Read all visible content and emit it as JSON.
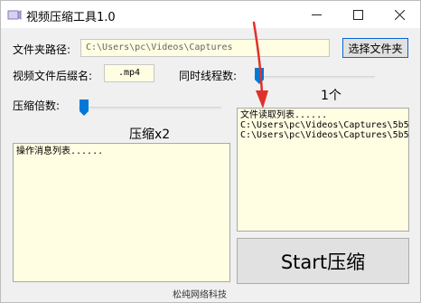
{
  "window": {
    "title": "视频压缩工具1.0",
    "icons": {
      "app": "app-icon",
      "minimize": "minimize-icon",
      "maximize": "maximize-icon",
      "close": "close-icon"
    }
  },
  "folder": {
    "label": "文件夹路径:",
    "path": "C:\\Users\\pc\\Videos\\Captures",
    "choose_button": "选择文件夹"
  },
  "extension": {
    "label": "视频文件后缀名:",
    "value": ".mp4"
  },
  "threads": {
    "label": "同时线程数:",
    "value_text": "1个",
    "slider_value": 1
  },
  "compression": {
    "label": "压缩倍数:",
    "value_text": "压缩x2",
    "slider_value": 2
  },
  "messages": {
    "lines": [
      "操作消息列表......"
    ]
  },
  "file_list": {
    "lines": [
      "文件读取列表......",
      "C:\\Users\\pc\\Videos\\Captures\\5b5",
      "C:\\Users\\pc\\Videos\\Captures\\5b5"
    ]
  },
  "start_button": "Start压缩",
  "footer": "松纯网络科技",
  "colors": {
    "window_bg": "#f0f0f0",
    "panel_bg": "#fffde2",
    "slider_thumb": "#0078d7",
    "annotation_arrow": "#e0302a"
  }
}
